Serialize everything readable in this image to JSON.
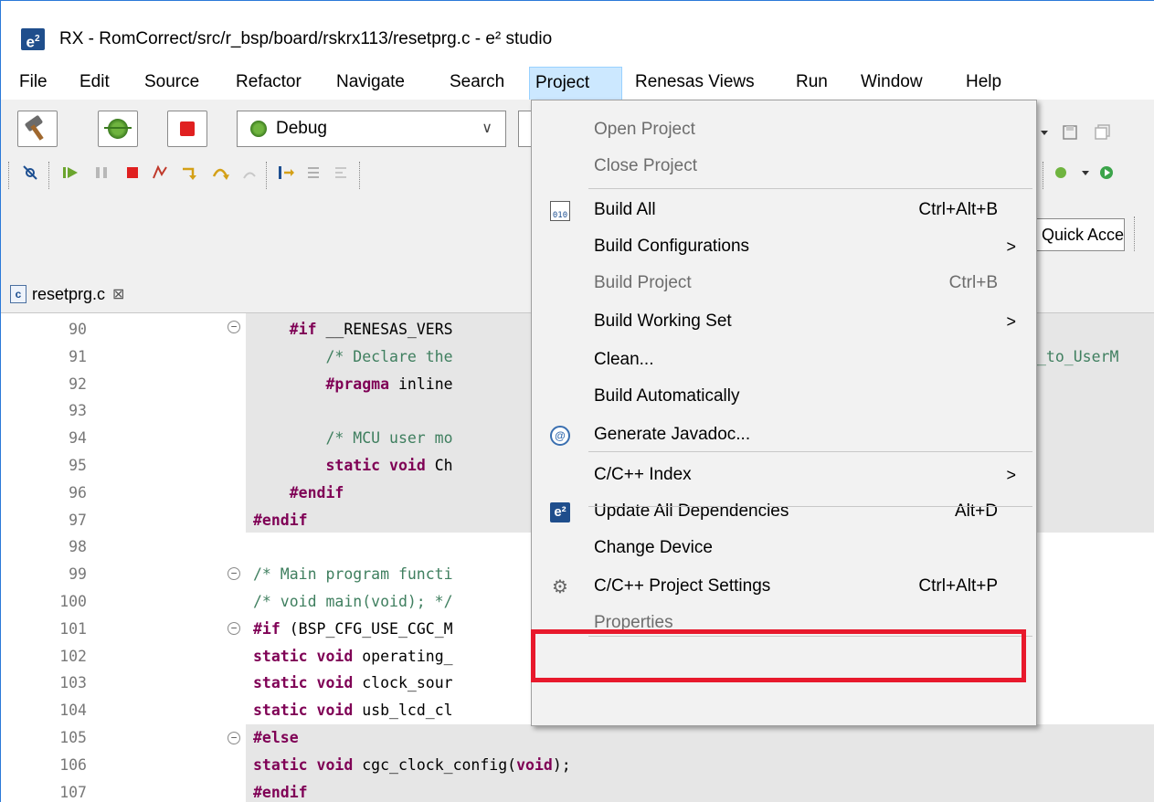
{
  "window": {
    "title": "RX - RomCorrect/src/r_bsp/board/rskrx113/resetprg.c - e² studio",
    "logo": "e²"
  },
  "menubar": [
    "File",
    "Edit",
    "Source",
    "Refactor",
    "Navigate",
    "Search",
    "Project",
    "Renesas Views",
    "Run",
    "Window",
    "Help"
  ],
  "toolbar": {
    "launch_config": "Debug",
    "quick_access": "Quick Access"
  },
  "editor": {
    "tab_label": "resetprg.c",
    "tab_icon": "c",
    "lines": [
      {
        "n": "90",
        "text": "    #if __RENESAS_VERS"
      },
      {
        "n": "91",
        "text": "        /* Declare the"
      },
      {
        "n": "92",
        "text": "        #pragma inline"
      },
      {
        "n": "93",
        "text": ""
      },
      {
        "n": "94",
        "text": "        /* MCU user mo"
      },
      {
        "n": "95",
        "text": "        static void Ch"
      },
      {
        "n": "96",
        "text": "    #endif"
      },
      {
        "n": "97",
        "text": "#endif"
      },
      {
        "n": "98",
        "text": ""
      },
      {
        "n": "99",
        "text": "/* Main program functi"
      },
      {
        "n": "100",
        "text": "/* void main(void); */"
      },
      {
        "n": "101",
        "text": "#if (BSP_CFG_USE_CGC_M"
      },
      {
        "n": "102",
        "text": "static void operating_"
      },
      {
        "n": "103",
        "text": "static void clock_sour"
      },
      {
        "n": "104",
        "text": "static void usb_lcd_cl"
      },
      {
        "n": "105",
        "text": "#else"
      },
      {
        "n": "106",
        "text": "static void cgc_clock_config(void);"
      },
      {
        "n": "107",
        "text": "#endif"
      }
    ],
    "right_fragment": "_to_UserM"
  },
  "project_menu": {
    "items": [
      {
        "label": "Open Project",
        "accel": "",
        "disabled": true,
        "submenu": false,
        "icon": ""
      },
      {
        "label": "Close Project",
        "accel": "",
        "disabled": true,
        "submenu": false,
        "icon": ""
      },
      {
        "label": "Build All",
        "accel": "Ctrl+Alt+B",
        "disabled": false,
        "submenu": false,
        "icon": "build-all-icon"
      },
      {
        "label": "Build Configurations",
        "accel": "",
        "disabled": false,
        "submenu": true,
        "icon": ""
      },
      {
        "label": "Build Project",
        "accel": "Ctrl+B",
        "disabled": true,
        "submenu": false,
        "icon": ""
      },
      {
        "label": "Build Working Set",
        "accel": "",
        "disabled": false,
        "submenu": true,
        "icon": ""
      },
      {
        "label": "Clean...",
        "accel": "",
        "disabled": false,
        "submenu": false,
        "icon": ""
      },
      {
        "label": "Build Automatically",
        "accel": "",
        "disabled": false,
        "submenu": false,
        "icon": ""
      },
      {
        "label": "Generate Javadoc...",
        "accel": "",
        "disabled": false,
        "submenu": false,
        "icon": "javadoc-icon"
      },
      {
        "label": "C/C++ Index",
        "accel": "",
        "disabled": false,
        "submenu": true,
        "icon": ""
      },
      {
        "label": "Update All Dependencies",
        "accel": "Alt+D",
        "disabled": false,
        "submenu": false,
        "icon": "e2-icon"
      },
      {
        "label": "Change Device",
        "accel": "",
        "disabled": false,
        "submenu": false,
        "icon": ""
      },
      {
        "label": "C/C++ Project Settings",
        "accel": "Ctrl+Alt+P",
        "disabled": false,
        "submenu": false,
        "icon": "settings-icon"
      },
      {
        "label": "Properties",
        "accel": "",
        "disabled": true,
        "submenu": false,
        "icon": ""
      }
    ],
    "submenu_arrow": ">"
  },
  "colors": {
    "highlight_box": "#e8192c",
    "menu_active": "#cce8ff"
  }
}
